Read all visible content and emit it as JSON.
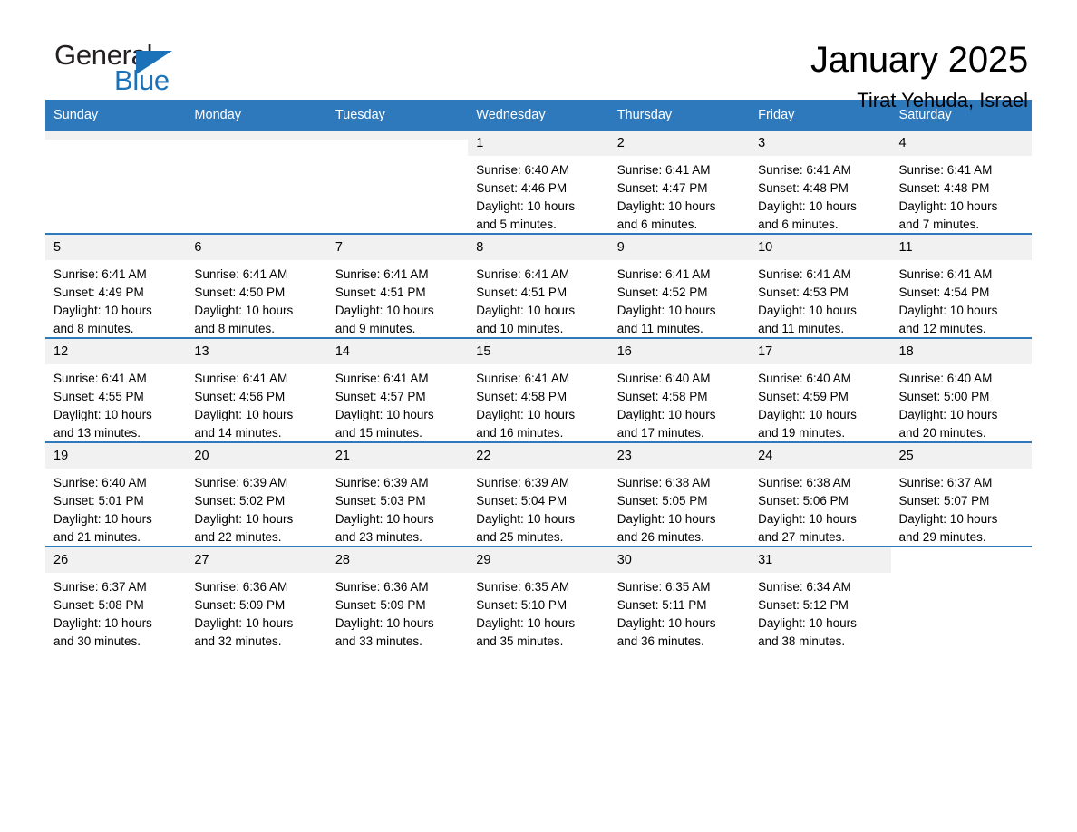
{
  "brand": {
    "word_general": "General",
    "word_blue": "Blue",
    "triangle_color": "#1c72b8"
  },
  "header": {
    "month_title": "January 2025",
    "location": "Tirat Yehuda, Israel",
    "accent_color": "#2e78bc"
  },
  "calendar": {
    "weekday_headers": [
      "Sunday",
      "Monday",
      "Tuesday",
      "Wednesday",
      "Thursday",
      "Friday",
      "Saturday"
    ],
    "labels": {
      "sunrise": "Sunrise:",
      "sunset": "Sunset:",
      "daylight": "Daylight:"
    },
    "weeks": [
      [
        {
          "day": "",
          "sunrise": "",
          "sunset": "",
          "daylight_1": "",
          "daylight_2": "",
          "empty": true,
          "blank": false
        },
        {
          "day": "",
          "sunrise": "",
          "sunset": "",
          "daylight_1": "",
          "daylight_2": "",
          "empty": true,
          "blank": false
        },
        {
          "day": "",
          "sunrise": "",
          "sunset": "",
          "daylight_1": "",
          "daylight_2": "",
          "empty": true,
          "blank": false
        },
        {
          "day": "1",
          "sunrise": "Sunrise: 6:40 AM",
          "sunset": "Sunset: 4:46 PM",
          "daylight_1": "Daylight: 10 hours",
          "daylight_2": "and 5 minutes.",
          "empty": false,
          "blank": false
        },
        {
          "day": "2",
          "sunrise": "Sunrise: 6:41 AM",
          "sunset": "Sunset: 4:47 PM",
          "daylight_1": "Daylight: 10 hours",
          "daylight_2": "and 6 minutes.",
          "empty": false,
          "blank": false
        },
        {
          "day": "3",
          "sunrise": "Sunrise: 6:41 AM",
          "sunset": "Sunset: 4:48 PM",
          "daylight_1": "Daylight: 10 hours",
          "daylight_2": "and 6 minutes.",
          "empty": false,
          "blank": false
        },
        {
          "day": "4",
          "sunrise": "Sunrise: 6:41 AM",
          "sunset": "Sunset: 4:48 PM",
          "daylight_1": "Daylight: 10 hours",
          "daylight_2": "and 7 minutes.",
          "empty": false,
          "blank": false
        }
      ],
      [
        {
          "day": "5",
          "sunrise": "Sunrise: 6:41 AM",
          "sunset": "Sunset: 4:49 PM",
          "daylight_1": "Daylight: 10 hours",
          "daylight_2": "and 8 minutes.",
          "empty": false,
          "blank": false
        },
        {
          "day": "6",
          "sunrise": "Sunrise: 6:41 AM",
          "sunset": "Sunset: 4:50 PM",
          "daylight_1": "Daylight: 10 hours",
          "daylight_2": "and 8 minutes.",
          "empty": false,
          "blank": false
        },
        {
          "day": "7",
          "sunrise": "Sunrise: 6:41 AM",
          "sunset": "Sunset: 4:51 PM",
          "daylight_1": "Daylight: 10 hours",
          "daylight_2": "and 9 minutes.",
          "empty": false,
          "blank": false
        },
        {
          "day": "8",
          "sunrise": "Sunrise: 6:41 AM",
          "sunset": "Sunset: 4:51 PM",
          "daylight_1": "Daylight: 10 hours",
          "daylight_2": "and 10 minutes.",
          "empty": false,
          "blank": false
        },
        {
          "day": "9",
          "sunrise": "Sunrise: 6:41 AM",
          "sunset": "Sunset: 4:52 PM",
          "daylight_1": "Daylight: 10 hours",
          "daylight_2": "and 11 minutes.",
          "empty": false,
          "blank": false
        },
        {
          "day": "10",
          "sunrise": "Sunrise: 6:41 AM",
          "sunset": "Sunset: 4:53 PM",
          "daylight_1": "Daylight: 10 hours",
          "daylight_2": "and 11 minutes.",
          "empty": false,
          "blank": false
        },
        {
          "day": "11",
          "sunrise": "Sunrise: 6:41 AM",
          "sunset": "Sunset: 4:54 PM",
          "daylight_1": "Daylight: 10 hours",
          "daylight_2": "and 12 minutes.",
          "empty": false,
          "blank": false
        }
      ],
      [
        {
          "day": "12",
          "sunrise": "Sunrise: 6:41 AM",
          "sunset": "Sunset: 4:55 PM",
          "daylight_1": "Daylight: 10 hours",
          "daylight_2": "and 13 minutes.",
          "empty": false,
          "blank": false
        },
        {
          "day": "13",
          "sunrise": "Sunrise: 6:41 AM",
          "sunset": "Sunset: 4:56 PM",
          "daylight_1": "Daylight: 10 hours",
          "daylight_2": "and 14 minutes.",
          "empty": false,
          "blank": false
        },
        {
          "day": "14",
          "sunrise": "Sunrise: 6:41 AM",
          "sunset": "Sunset: 4:57 PM",
          "daylight_1": "Daylight: 10 hours",
          "daylight_2": "and 15 minutes.",
          "empty": false,
          "blank": false
        },
        {
          "day": "15",
          "sunrise": "Sunrise: 6:41 AM",
          "sunset": "Sunset: 4:58 PM",
          "daylight_1": "Daylight: 10 hours",
          "daylight_2": "and 16 minutes.",
          "empty": false,
          "blank": false
        },
        {
          "day": "16",
          "sunrise": "Sunrise: 6:40 AM",
          "sunset": "Sunset: 4:58 PM",
          "daylight_1": "Daylight: 10 hours",
          "daylight_2": "and 17 minutes.",
          "empty": false,
          "blank": false
        },
        {
          "day": "17",
          "sunrise": "Sunrise: 6:40 AM",
          "sunset": "Sunset: 4:59 PM",
          "daylight_1": "Daylight: 10 hours",
          "daylight_2": "and 19 minutes.",
          "empty": false,
          "blank": false
        },
        {
          "day": "18",
          "sunrise": "Sunrise: 6:40 AM",
          "sunset": "Sunset: 5:00 PM",
          "daylight_1": "Daylight: 10 hours",
          "daylight_2": "and 20 minutes.",
          "empty": false,
          "blank": false
        }
      ],
      [
        {
          "day": "19",
          "sunrise": "Sunrise: 6:40 AM",
          "sunset": "Sunset: 5:01 PM",
          "daylight_1": "Daylight: 10 hours",
          "daylight_2": "and 21 minutes.",
          "empty": false,
          "blank": false
        },
        {
          "day": "20",
          "sunrise": "Sunrise: 6:39 AM",
          "sunset": "Sunset: 5:02 PM",
          "daylight_1": "Daylight: 10 hours",
          "daylight_2": "and 22 minutes.",
          "empty": false,
          "blank": false
        },
        {
          "day": "21",
          "sunrise": "Sunrise: 6:39 AM",
          "sunset": "Sunset: 5:03 PM",
          "daylight_1": "Daylight: 10 hours",
          "daylight_2": "and 23 minutes.",
          "empty": false,
          "blank": false
        },
        {
          "day": "22",
          "sunrise": "Sunrise: 6:39 AM",
          "sunset": "Sunset: 5:04 PM",
          "daylight_1": "Daylight: 10 hours",
          "daylight_2": "and 25 minutes.",
          "empty": false,
          "blank": false
        },
        {
          "day": "23",
          "sunrise": "Sunrise: 6:38 AM",
          "sunset": "Sunset: 5:05 PM",
          "daylight_1": "Daylight: 10 hours",
          "daylight_2": "and 26 minutes.",
          "empty": false,
          "blank": false
        },
        {
          "day": "24",
          "sunrise": "Sunrise: 6:38 AM",
          "sunset": "Sunset: 5:06 PM",
          "daylight_1": "Daylight: 10 hours",
          "daylight_2": "and 27 minutes.",
          "empty": false,
          "blank": false
        },
        {
          "day": "25",
          "sunrise": "Sunrise: 6:37 AM",
          "sunset": "Sunset: 5:07 PM",
          "daylight_1": "Daylight: 10 hours",
          "daylight_2": "and 29 minutes.",
          "empty": false,
          "blank": false
        }
      ],
      [
        {
          "day": "26",
          "sunrise": "Sunrise: 6:37 AM",
          "sunset": "Sunset: 5:08 PM",
          "daylight_1": "Daylight: 10 hours",
          "daylight_2": "and 30 minutes.",
          "empty": false,
          "blank": false
        },
        {
          "day": "27",
          "sunrise": "Sunrise: 6:36 AM",
          "sunset": "Sunset: 5:09 PM",
          "daylight_1": "Daylight: 10 hours",
          "daylight_2": "and 32 minutes.",
          "empty": false,
          "blank": false
        },
        {
          "day": "28",
          "sunrise": "Sunrise: 6:36 AM",
          "sunset": "Sunset: 5:09 PM",
          "daylight_1": "Daylight: 10 hours",
          "daylight_2": "and 33 minutes.",
          "empty": false,
          "blank": false
        },
        {
          "day": "29",
          "sunrise": "Sunrise: 6:35 AM",
          "sunset": "Sunset: 5:10 PM",
          "daylight_1": "Daylight: 10 hours",
          "daylight_2": "and 35 minutes.",
          "empty": false,
          "blank": false
        },
        {
          "day": "30",
          "sunrise": "Sunrise: 6:35 AM",
          "sunset": "Sunset: 5:11 PM",
          "daylight_1": "Daylight: 10 hours",
          "daylight_2": "and 36 minutes.",
          "empty": false,
          "blank": false
        },
        {
          "day": "31",
          "sunrise": "Sunrise: 6:34 AM",
          "sunset": "Sunset: 5:12 PM",
          "daylight_1": "Daylight: 10 hours",
          "daylight_2": "and 38 minutes.",
          "empty": false,
          "blank": false
        },
        {
          "day": "",
          "sunrise": "",
          "sunset": "",
          "daylight_1": "",
          "daylight_2": "",
          "empty": false,
          "blank": true
        }
      ]
    ]
  }
}
